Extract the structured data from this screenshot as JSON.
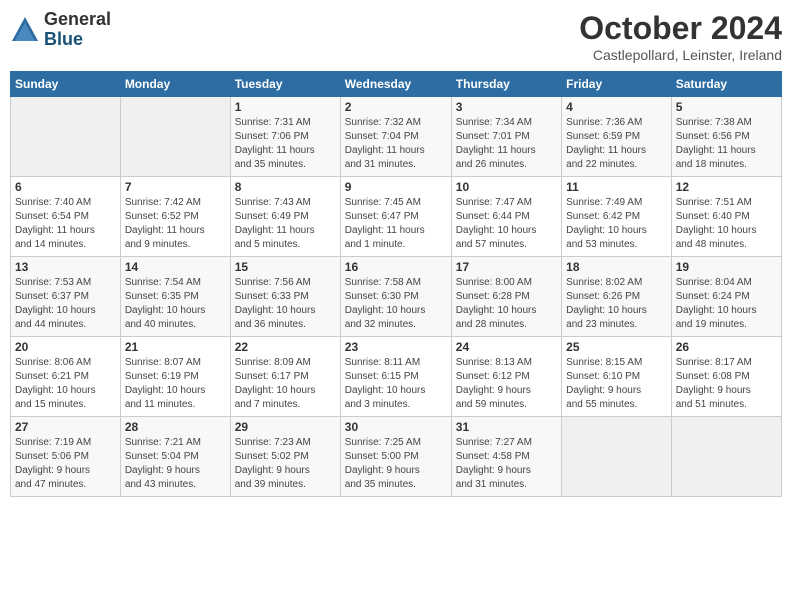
{
  "logo": {
    "general": "General",
    "blue": "Blue"
  },
  "title": "October 2024",
  "subtitle": "Castlepollard, Leinster, Ireland",
  "days_header": [
    "Sunday",
    "Monday",
    "Tuesday",
    "Wednesday",
    "Thursday",
    "Friday",
    "Saturday"
  ],
  "weeks": [
    [
      {
        "day": "",
        "info": ""
      },
      {
        "day": "",
        "info": ""
      },
      {
        "day": "1",
        "info": "Sunrise: 7:31 AM\nSunset: 7:06 PM\nDaylight: 11 hours\nand 35 minutes."
      },
      {
        "day": "2",
        "info": "Sunrise: 7:32 AM\nSunset: 7:04 PM\nDaylight: 11 hours\nand 31 minutes."
      },
      {
        "day": "3",
        "info": "Sunrise: 7:34 AM\nSunset: 7:01 PM\nDaylight: 11 hours\nand 26 minutes."
      },
      {
        "day": "4",
        "info": "Sunrise: 7:36 AM\nSunset: 6:59 PM\nDaylight: 11 hours\nand 22 minutes."
      },
      {
        "day": "5",
        "info": "Sunrise: 7:38 AM\nSunset: 6:56 PM\nDaylight: 11 hours\nand 18 minutes."
      }
    ],
    [
      {
        "day": "6",
        "info": "Sunrise: 7:40 AM\nSunset: 6:54 PM\nDaylight: 11 hours\nand 14 minutes."
      },
      {
        "day": "7",
        "info": "Sunrise: 7:42 AM\nSunset: 6:52 PM\nDaylight: 11 hours\nand 9 minutes."
      },
      {
        "day": "8",
        "info": "Sunrise: 7:43 AM\nSunset: 6:49 PM\nDaylight: 11 hours\nand 5 minutes."
      },
      {
        "day": "9",
        "info": "Sunrise: 7:45 AM\nSunset: 6:47 PM\nDaylight: 11 hours\nand 1 minute."
      },
      {
        "day": "10",
        "info": "Sunrise: 7:47 AM\nSunset: 6:44 PM\nDaylight: 10 hours\nand 57 minutes."
      },
      {
        "day": "11",
        "info": "Sunrise: 7:49 AM\nSunset: 6:42 PM\nDaylight: 10 hours\nand 53 minutes."
      },
      {
        "day": "12",
        "info": "Sunrise: 7:51 AM\nSunset: 6:40 PM\nDaylight: 10 hours\nand 48 minutes."
      }
    ],
    [
      {
        "day": "13",
        "info": "Sunrise: 7:53 AM\nSunset: 6:37 PM\nDaylight: 10 hours\nand 44 minutes."
      },
      {
        "day": "14",
        "info": "Sunrise: 7:54 AM\nSunset: 6:35 PM\nDaylight: 10 hours\nand 40 minutes."
      },
      {
        "day": "15",
        "info": "Sunrise: 7:56 AM\nSunset: 6:33 PM\nDaylight: 10 hours\nand 36 minutes."
      },
      {
        "day": "16",
        "info": "Sunrise: 7:58 AM\nSunset: 6:30 PM\nDaylight: 10 hours\nand 32 minutes."
      },
      {
        "day": "17",
        "info": "Sunrise: 8:00 AM\nSunset: 6:28 PM\nDaylight: 10 hours\nand 28 minutes."
      },
      {
        "day": "18",
        "info": "Sunrise: 8:02 AM\nSunset: 6:26 PM\nDaylight: 10 hours\nand 23 minutes."
      },
      {
        "day": "19",
        "info": "Sunrise: 8:04 AM\nSunset: 6:24 PM\nDaylight: 10 hours\nand 19 minutes."
      }
    ],
    [
      {
        "day": "20",
        "info": "Sunrise: 8:06 AM\nSunset: 6:21 PM\nDaylight: 10 hours\nand 15 minutes."
      },
      {
        "day": "21",
        "info": "Sunrise: 8:07 AM\nSunset: 6:19 PM\nDaylight: 10 hours\nand 11 minutes."
      },
      {
        "day": "22",
        "info": "Sunrise: 8:09 AM\nSunset: 6:17 PM\nDaylight: 10 hours\nand 7 minutes."
      },
      {
        "day": "23",
        "info": "Sunrise: 8:11 AM\nSunset: 6:15 PM\nDaylight: 10 hours\nand 3 minutes."
      },
      {
        "day": "24",
        "info": "Sunrise: 8:13 AM\nSunset: 6:12 PM\nDaylight: 9 hours\nand 59 minutes."
      },
      {
        "day": "25",
        "info": "Sunrise: 8:15 AM\nSunset: 6:10 PM\nDaylight: 9 hours\nand 55 minutes."
      },
      {
        "day": "26",
        "info": "Sunrise: 8:17 AM\nSunset: 6:08 PM\nDaylight: 9 hours\nand 51 minutes."
      }
    ],
    [
      {
        "day": "27",
        "info": "Sunrise: 7:19 AM\nSunset: 5:06 PM\nDaylight: 9 hours\nand 47 minutes."
      },
      {
        "day": "28",
        "info": "Sunrise: 7:21 AM\nSunset: 5:04 PM\nDaylight: 9 hours\nand 43 minutes."
      },
      {
        "day": "29",
        "info": "Sunrise: 7:23 AM\nSunset: 5:02 PM\nDaylight: 9 hours\nand 39 minutes."
      },
      {
        "day": "30",
        "info": "Sunrise: 7:25 AM\nSunset: 5:00 PM\nDaylight: 9 hours\nand 35 minutes."
      },
      {
        "day": "31",
        "info": "Sunrise: 7:27 AM\nSunset: 4:58 PM\nDaylight: 9 hours\nand 31 minutes."
      },
      {
        "day": "",
        "info": ""
      },
      {
        "day": "",
        "info": ""
      }
    ]
  ]
}
